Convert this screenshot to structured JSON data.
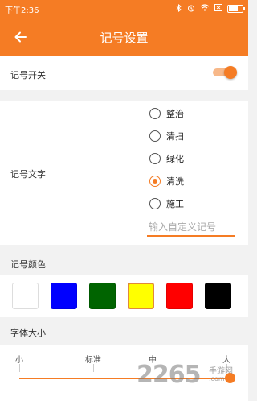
{
  "status_bar": {
    "time": "下午2:36",
    "battery_label": "",
    "battery_level": 0.8,
    "sim_label": "▢"
  },
  "app_bar": {
    "back_icon": "arrow-left-icon",
    "title": "记号设置"
  },
  "toggle_row": {
    "label": "记号开关",
    "enabled": true
  },
  "mark_text": {
    "label": "记号文字",
    "options": [
      "整治",
      "清扫",
      "绿化",
      "清洗",
      "施工"
    ],
    "selected_index": 3,
    "custom_placeholder": "输入自定义记号"
  },
  "mark_color": {
    "label": "记号颜色",
    "swatches": [
      "#ffffff",
      "#0000ff",
      "#006400",
      "#ffff00",
      "#ff0000",
      "#000000"
    ],
    "selected_index": 3
  },
  "font_size": {
    "label": "字体大小",
    "levels": [
      "小",
      "标准",
      "中",
      "大"
    ],
    "selected_index": 3
  },
  "watermark": {
    "text": "2265",
    "sub1": "手游网",
    "sub2": ".com"
  },
  "colors": {
    "accent": "#f57c24"
  }
}
